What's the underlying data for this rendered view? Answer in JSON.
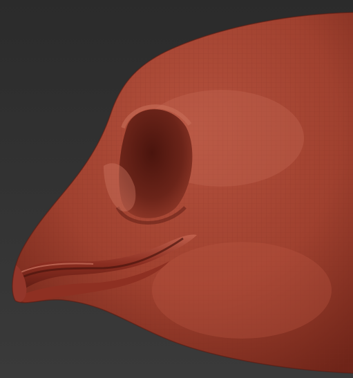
{
  "viewport": {
    "background_top": "#2b2b2b",
    "background_bottom": "#3a3a3a",
    "subject": "sculpted-creature-head",
    "material": {
      "base": "#a3402f",
      "highlight": "#d27a66",
      "shadow": "#5a1a12",
      "wireframe": "#7a2a1e"
    }
  }
}
